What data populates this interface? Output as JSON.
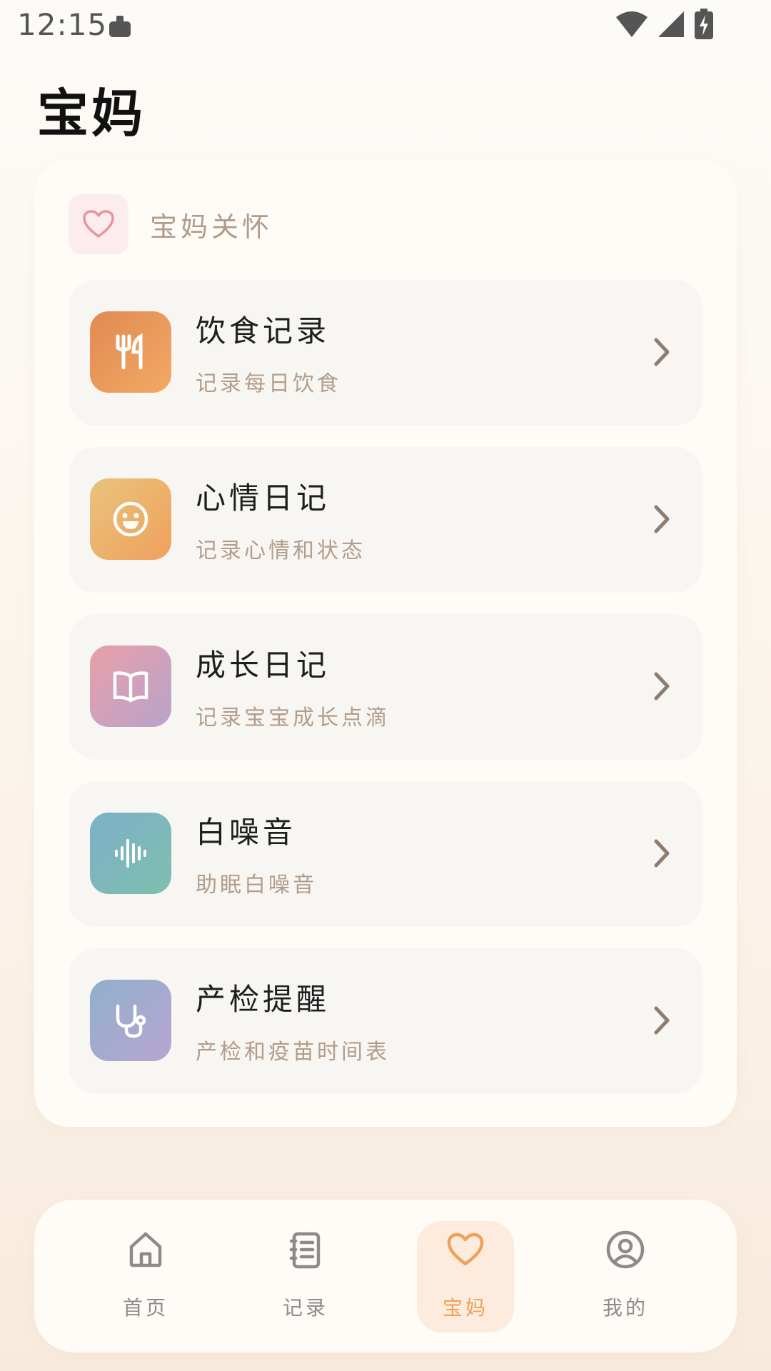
{
  "status_bar": {
    "time": "12:15"
  },
  "page": {
    "title": "宝妈"
  },
  "section": {
    "title": "宝妈关怀",
    "icon": "heart-outline-icon"
  },
  "menu": [
    {
      "title": "饮食记录",
      "subtitle": "记录每日饮食",
      "icon": "utensils-icon",
      "gradient": [
        "#e08a52",
        "#f3a964"
      ]
    },
    {
      "title": "心情日记",
      "subtitle": "记录心情和状态",
      "icon": "smile-icon",
      "gradient": [
        "#e8c47c",
        "#f0a05c"
      ]
    },
    {
      "title": "成长日记",
      "subtitle": "记录宝宝成长点滴",
      "icon": "open-book-icon",
      "gradient": [
        "#e8a0a8",
        "#b9a2cc"
      ]
    },
    {
      "title": "白噪音",
      "subtitle": "助眠白噪音",
      "icon": "sound-wave-icon",
      "gradient": [
        "#7cb0c8",
        "#7fbfae"
      ]
    },
    {
      "title": "产检提醒",
      "subtitle": "产检和疫苗时间表",
      "icon": "stethoscope-icon",
      "gradient": [
        "#90b0cc",
        "#b8a4d0"
      ]
    }
  ],
  "bottom_nav": {
    "active": "宝妈",
    "items": [
      {
        "label": "首页",
        "icon": "home-icon"
      },
      {
        "label": "记录",
        "icon": "notebook-icon"
      },
      {
        "label": "宝妈",
        "icon": "heart-icon"
      },
      {
        "label": "我的",
        "icon": "user-circle-icon"
      }
    ]
  },
  "colors": {
    "accent": "#f0a05a",
    "subtitle_text": "#b39d8b",
    "card_bg": "#fffcf8",
    "item_bg": "#f8f6f3",
    "heart_pink": "#e9939b"
  }
}
